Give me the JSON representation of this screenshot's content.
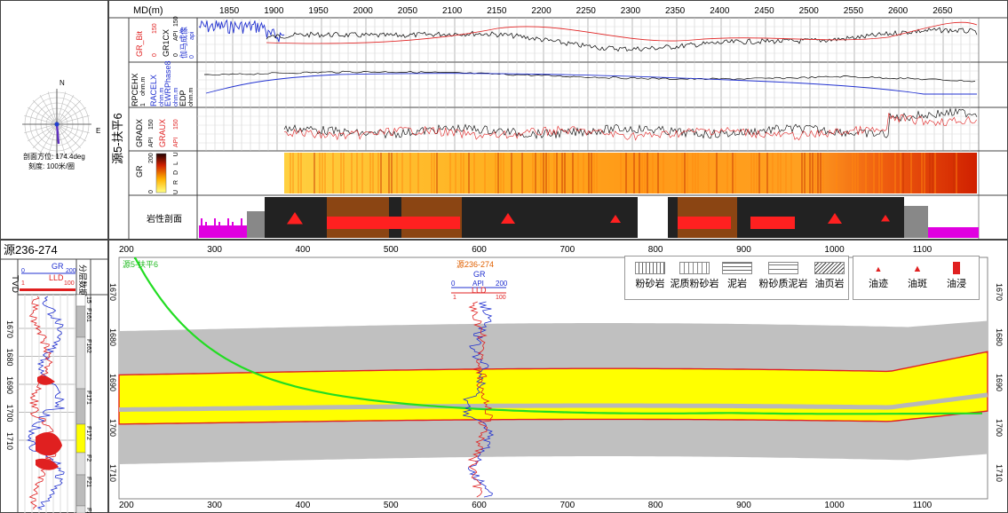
{
  "compass": {
    "north": "N",
    "east": "E",
    "azimuth_label": "剖面方位: 174.4deg",
    "scale_label": "刻度: 100米/圈"
  },
  "top_panel": {
    "md_axis_label": "MD(m)",
    "md_ticks": [
      "1850",
      "1900",
      "1950",
      "2000",
      "2050",
      "2100",
      "2150",
      "2200",
      "2250",
      "2300",
      "2350",
      "2400",
      "2450",
      "2500",
      "2550",
      "2600",
      "2650"
    ],
    "well_name": "源5-扶平6",
    "tracks": [
      {
        "curves": [
          {
            "name": "GR_Bit",
            "unit": "",
            "min": "0",
            "max": "150",
            "color": "#e02020"
          },
          {
            "name": "GR1CX",
            "unit": "API",
            "min": "0",
            "max": "150",
            "color": "#000000"
          },
          {
            "name": "伽马成像",
            "unit": "api",
            "min": "0",
            "max": "150",
            "color": "#2030d0"
          }
        ]
      },
      {
        "curves": [
          {
            "name": "RPCEHX",
            "unit": "ohm.m",
            "min": "1",
            "max": "100",
            "color": "#000000"
          },
          {
            "name": "RACELX",
            "unit": "ohm.m",
            "min": "1",
            "max": "100",
            "color": "#2030d0"
          },
          {
            "name": "EWRPhase8",
            "unit": "ohm.m",
            "min": "1",
            "max": "100",
            "color": "#2030d0"
          },
          {
            "name": "EDP",
            "unit": "ohm.m",
            "min": "1",
            "max": "100",
            "color": "#000000"
          }
        ]
      },
      {
        "curves": [
          {
            "name": "GRADX",
            "unit": "API",
            "min": "0",
            "max": "150",
            "color": "#000000"
          },
          {
            "name": "GRAUX",
            "unit": "API",
            "min": "0",
            "max": "150",
            "color": "#e02020"
          }
        ]
      }
    ],
    "image_track": {
      "name": "GR",
      "min": "0",
      "max": "200",
      "dirs": "U R D L U"
    },
    "lithology_label": "岩性剖面"
  },
  "left_well": {
    "title": "源236-274",
    "tvd_label": "TVD",
    "gr_label": "GR",
    "gr_min": "0",
    "gr_max": "200",
    "lld_label": "LLD",
    "lld_min": "1",
    "lld_max": "100",
    "layer_col_label": "分层数据",
    "tvd_ticks": [
      "1670",
      "1680",
      "1690",
      "1700",
      "1710"
    ],
    "layers": [
      "15",
      "F161",
      "F162",
      "F171",
      "F172",
      "F2",
      "F21",
      "F21"
    ]
  },
  "section": {
    "x_ticks": [
      "200",
      "300",
      "400",
      "500",
      "600",
      "700",
      "800",
      "900",
      "1000",
      "1100"
    ],
    "y_ticks": [
      "1670",
      "1680",
      "1690",
      "1700",
      "1710"
    ],
    "well_label_green": "源5-扶平6",
    "well_label_center": "源236-274",
    "center_gr": "GR",
    "center_api": "API",
    "center_gr_min": "0",
    "center_gr_max": "200",
    "center_lld": "LLD",
    "center_lld_min": "1",
    "center_lld_max": "100"
  },
  "legend": {
    "rocks": [
      "粉砂岩",
      "泥质粉砂岩",
      "泥岩",
      "粉砂质泥岩",
      "油页岩"
    ],
    "shows": [
      "油迹",
      "油斑",
      "油浸"
    ]
  }
}
